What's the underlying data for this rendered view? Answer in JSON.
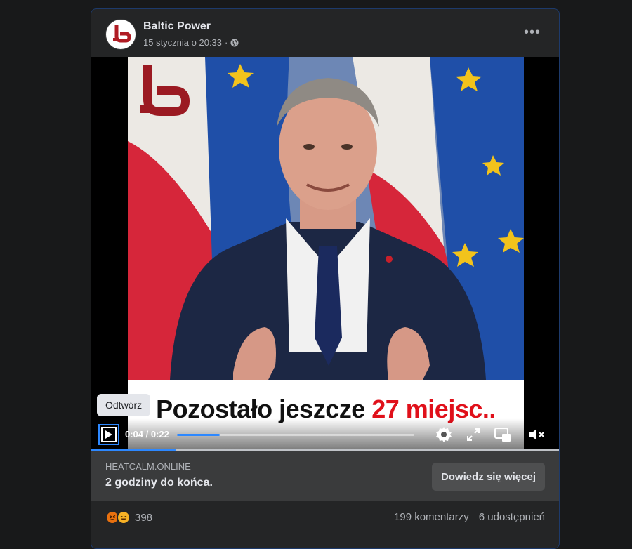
{
  "post": {
    "page_name": "Baltic Power",
    "timestamp": "15 stycznia o 20:33",
    "separator": "·",
    "privacy_icon": "globe-icon",
    "more_label": "•••"
  },
  "video": {
    "subtitle_prefix": "Pozostało jeszcze ",
    "subtitle_highlight": "27 miejsc..",
    "tooltip": "Odtwórz",
    "time": "0:04 / 0:22",
    "progress": 0.18,
    "icons": [
      "play-icon",
      "settings-icon",
      "fullscreen-icon",
      "picture-in-picture-icon",
      "mute-icon"
    ],
    "accent_color": "#2d88ff",
    "highlight_color": "#e0101a"
  },
  "link": {
    "domain": "HEATCALM.ONLINE",
    "title": "2 godziny do końca.",
    "cta_label": "Dowiedz się więcej"
  },
  "stats": {
    "reaction_icons": [
      "angry-icon",
      "haha-icon"
    ],
    "reaction_count": "398",
    "comments": "199 komentarzy",
    "shares": "6 udostępnień"
  }
}
